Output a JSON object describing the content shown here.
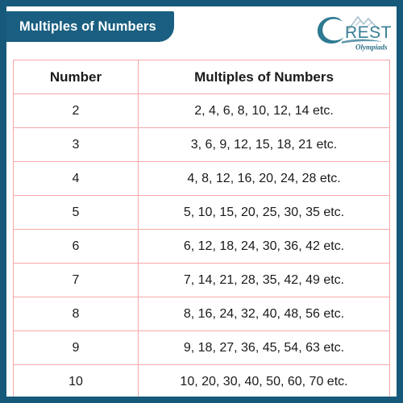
{
  "header": {
    "title": "Multiples of Numbers",
    "banner_bg": "#1a5f81",
    "banner_text_color": "#ffffff"
  },
  "logo": {
    "brand_c": "C",
    "brand_rest": "REST",
    "tagline": "Olympiads",
    "icon_name": "mountain-peaks-icon",
    "color_primary": "#2e7a91",
    "color_secondary": "#9bb7c4"
  },
  "frame": {
    "border_color": "#17597b",
    "background": "#ffffff"
  },
  "table": {
    "border_color": "#f7a8a8",
    "columns": [
      "Number",
      "Multiples of Numbers"
    ],
    "rows": [
      {
        "number": "2",
        "multiples": "2, 4, 6, 8, 10, 12, 14 etc."
      },
      {
        "number": "3",
        "multiples": "3, 6, 9, 12, 15, 18, 21 etc."
      },
      {
        "number": "4",
        "multiples": "4, 8, 12, 16, 20, 24, 28 etc."
      },
      {
        "number": "5",
        "multiples": "5, 10, 15, 20, 25, 30, 35 etc."
      },
      {
        "number": "6",
        "multiples": "6, 12, 18, 24, 30, 36, 42 etc."
      },
      {
        "number": "7",
        "multiples": "7, 14, 21, 28, 35, 42, 49 etc."
      },
      {
        "number": "8",
        "multiples": "8, 16, 24, 32, 40, 48, 56 etc."
      },
      {
        "number": "9",
        "multiples": "9, 18, 27, 36, 45, 54, 63 etc."
      },
      {
        "number": "10",
        "multiples": "10, 20, 30, 40, 50, 60, 70 etc."
      }
    ]
  }
}
